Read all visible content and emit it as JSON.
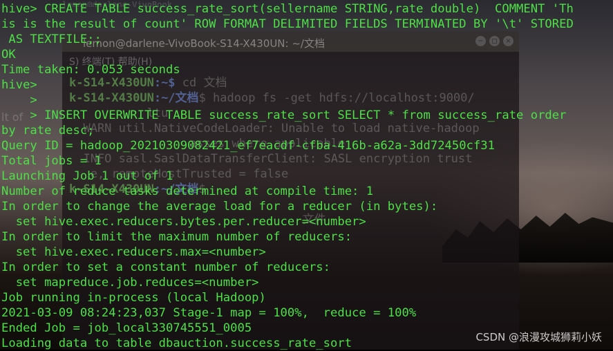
{
  "background_window": {
    "title": "lemon@darlene-VivoBook-S14-X430UN: ~/文档",
    "controls": [
      "−",
      "◻",
      "×"
    ],
    "menubar": "S)  终端(T)  帮助(H)",
    "side_text": "lt of",
    "top_strip": "lemon@darlene-VivoBook",
    "lines": [
      {
        "host": "k-S14-X430UN",
        "path": ":~$",
        "cmd": " cd 文档"
      },
      {
        "host": "k-S14-X430UN",
        "path": ":~/文档",
        "cmd": "$ hadoop fs -get hdfs://localhost:9000/"
      },
      {
        "host": "",
        "path": "",
        "cmd": "           ltu"
      },
      {
        "host": "",
        "path": "",
        "cmd": "  WARN util.NativeCodeLoader: Unable to load native-hadoop"
      },
      {
        "host": "",
        "path": "",
        "cmd": "                 asses where applicable"
      },
      {
        "host": "",
        "path": "",
        "cmd": "  INFO sasl.SaslDataTransferClient: SASL encryption trust"
      },
      {
        "host": "",
        "path": "",
        "cmd": "   e, remoteHostTrusted = false"
      },
      {
        "host": "k-S14-X430UN",
        "path": ":~/文档",
        "cmd": "$"
      },
      {
        "host": "",
        "path": "",
        "cmd": ""
      },
      {
        "host": "",
        "path": "",
        "cmd": "                                 文件"
      }
    ]
  },
  "terminal": {
    "lines": [
      "hive> CREATE TABLE success_rate_sort(sellername STRING,rate double)  COMMENT 'Th",
      "is is the result of count' ROW FORMAT DELIMITED FIELDS TERMINATED BY '\\t' STORED",
      " AS TEXTFILE;;",
      "OK",
      "Time taken: 0.053 seconds",
      "hive>",
      "    >",
      "    > INSERT OVERWRITE TABLE success_rate_sort SELECT * from success_rate order",
      "by rate desc;",
      "Query ID = hadoop_20210309082421_ef7eacdf-cfba-416b-a62a-3dd72450cf31",
      "Total jobs = 1",
      "Launching Job 1 out of 1",
      "Number of reduce tasks determined at compile time: 1",
      "In order to change the average load for a reducer (in bytes):",
      "  set hive.exec.reducers.bytes.per.reducer=<number>",
      "In order to limit the maximum number of reducers:",
      "  set hive.exec.reducers.max=<number>",
      "In order to set a constant number of reducers:",
      "  set mapreduce.job.reduces=<number>",
      "Job running in-process (local Hadoop)",
      "2021-03-09 08:24:23,037 Stage-1 map = 100%,  reduce = 100%",
      "Ended Job = job_local330745551_0005",
      "Loading data to table dbauction.success_rate_sort"
    ]
  },
  "watermark": "CSDN @浪漫攻城狮莉小妖",
  "colors": {
    "terminal_text": "#4ee047",
    "background": "#000000"
  }
}
